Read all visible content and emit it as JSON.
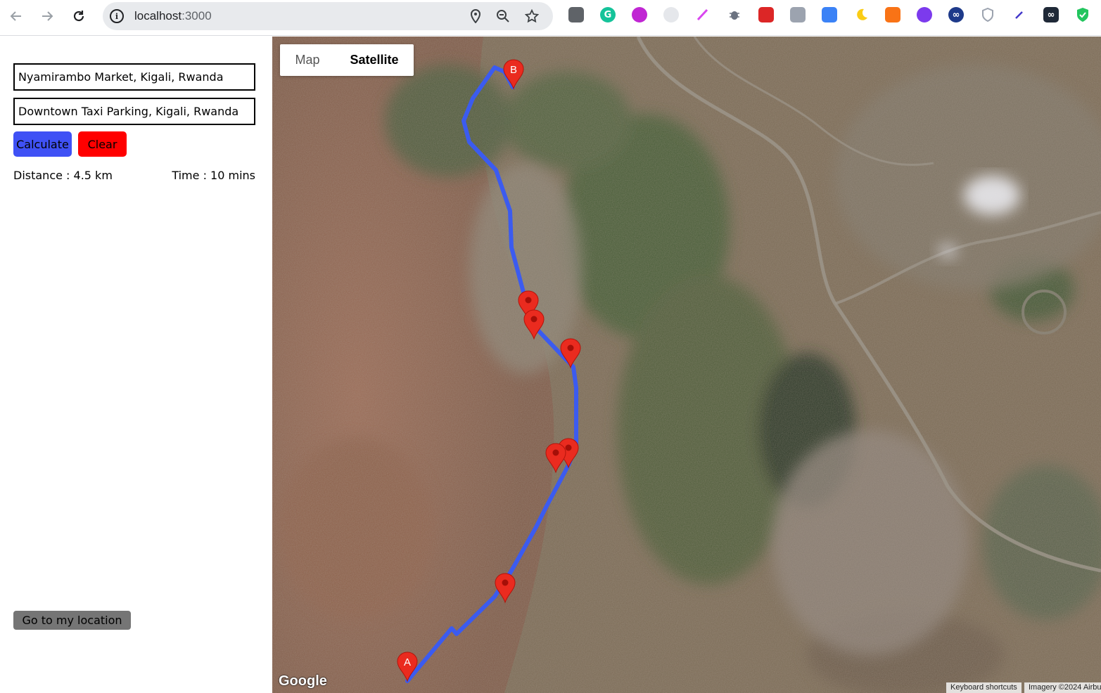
{
  "browser": {
    "url_host": "localhost",
    "url_port": ":3000"
  },
  "form": {
    "origin_value": "Nyamirambo Market, Kigali, Rwanda",
    "destination_value": "Downtown Taxi Parking, Kigali, Rwanda",
    "calculate_label": "Calculate",
    "clear_label": "Clear",
    "distance_text": "Distance : 4.5 km",
    "time_text": "Time : 10 mins",
    "my_location_label": "Go to my location"
  },
  "colors": {
    "calculate_bg": "#3f51f5",
    "clear_bg": "#ff0000",
    "route": "#3b5bf0",
    "marker": "#ea2b1f"
  },
  "map": {
    "type_options": [
      "Map",
      "Satellite"
    ],
    "selected_type": "Satellite",
    "origin_label": "A",
    "destination_label": "B",
    "intermediate_marker_count": 7,
    "logo_text": "Google",
    "keyboard_shortcuts": "Keyboard shortcuts",
    "imagery": "Imagery ©2024 Airbus"
  }
}
